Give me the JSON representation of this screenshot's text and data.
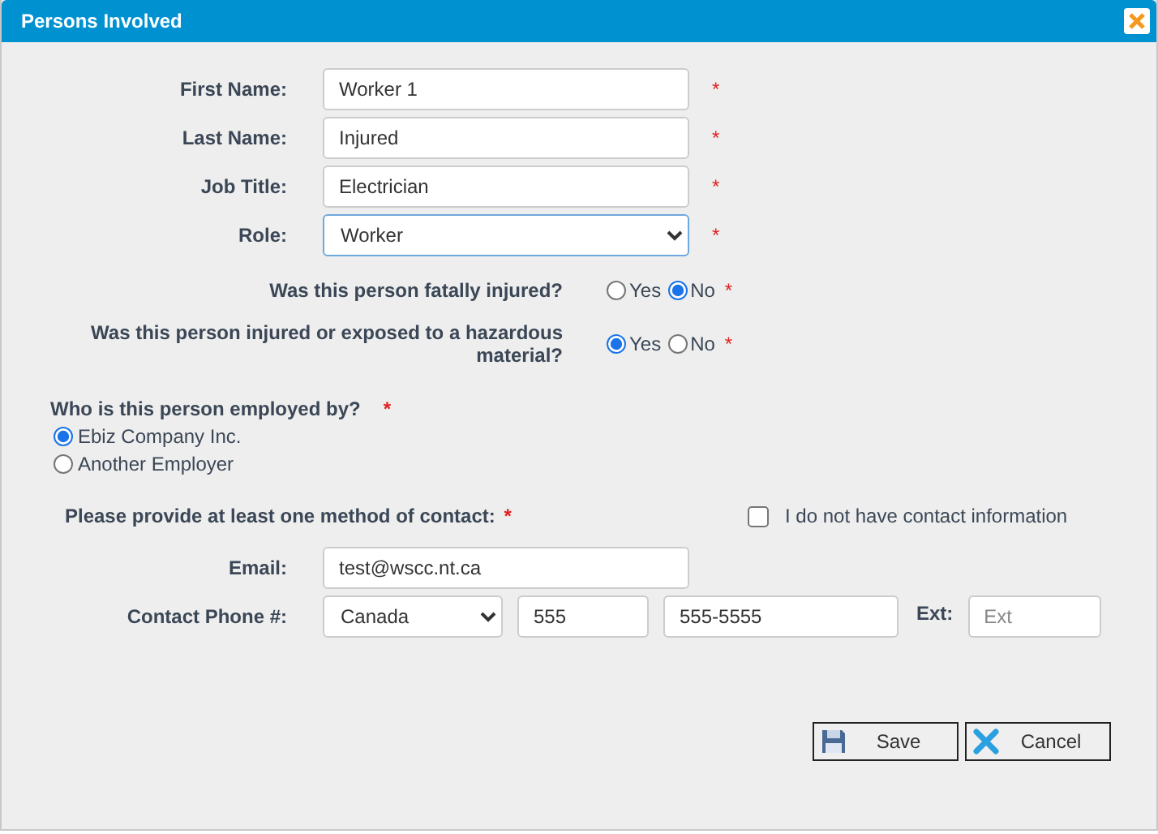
{
  "window": {
    "title": "Persons Involved"
  },
  "fields": [
    {
      "label": "First Name:",
      "kind": "text",
      "value": "Worker 1",
      "required_mark": "*"
    },
    {
      "label": "Last Name:",
      "kind": "text",
      "value": "Injured",
      "required_mark": "*"
    },
    {
      "label": "Job Title:",
      "kind": "text",
      "value": "Electrician",
      "required_mark": "*"
    },
    {
      "label": "Role:",
      "kind": "select",
      "value": "Worker",
      "required_mark": "*"
    }
  ],
  "questions": [
    {
      "label": "Was this person fatally injured?",
      "required_mark": "*",
      "options": [
        {
          "label": "Yes",
          "selected": false
        },
        {
          "label": "No",
          "selected": true
        }
      ]
    },
    {
      "label": "Was this person injured or exposed to a hazardous material?",
      "required_mark": "*",
      "options": [
        {
          "label": "Yes",
          "selected": true
        },
        {
          "label": "No",
          "selected": false
        }
      ]
    }
  ],
  "employer": {
    "label": "Who is this person employed by?",
    "required_mark": "*",
    "options": [
      {
        "label": "Ebiz Company Inc.",
        "selected": true
      },
      {
        "label": "Another Employer",
        "selected": false
      }
    ]
  },
  "contact": {
    "label": "Please provide at least one method of contact:",
    "required_mark": "*",
    "no_contact": {
      "label": "I do not have contact information",
      "checked": false
    },
    "email": {
      "label": "Email:",
      "value": "test@wscc.nt.ca"
    },
    "phone": {
      "label": "Contact Phone #:",
      "country": "Canada",
      "area_code": "555",
      "number": "555-5555",
      "ext_label": "Ext:",
      "ext_placeholder": "Ext"
    }
  },
  "buttons": [
    {
      "label": "Save",
      "kind": "save"
    },
    {
      "label": "Cancel",
      "kind": "cancel"
    }
  ]
}
